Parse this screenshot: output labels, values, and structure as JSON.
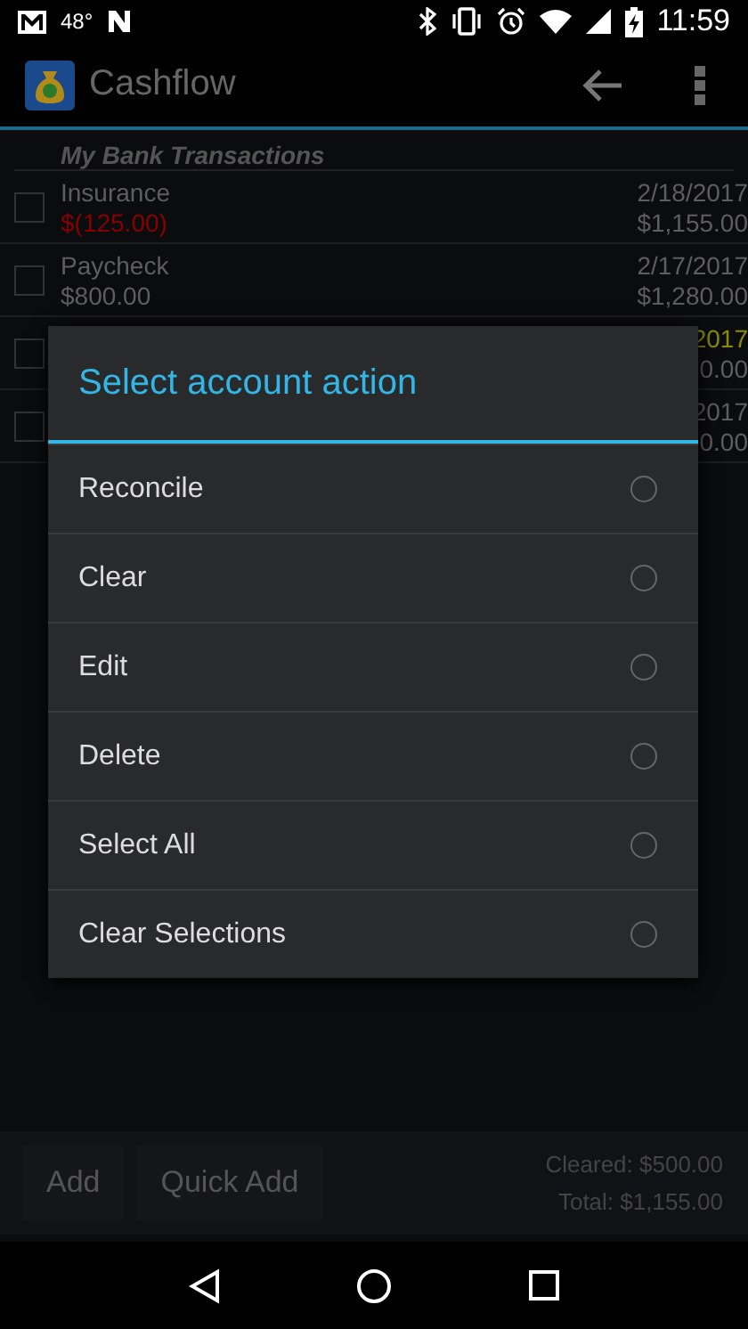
{
  "status_bar": {
    "temperature": "48°",
    "time": "11:59"
  },
  "app_bar": {
    "title": "Cashflow"
  },
  "section_title": "My Bank Transactions",
  "transactions": [
    {
      "name": "Insurance",
      "amount": "$(125.00)",
      "negative": true,
      "date": "2/18/2017",
      "balance": "$1,155.00",
      "checked": false
    },
    {
      "name": "Paycheck",
      "amount": "$800.00",
      "negative": false,
      "date": "2/17/2017",
      "balance": "$1,280.00",
      "checked": false
    },
    {
      "date": "2017",
      "balance": "0.00",
      "color": "#8c8c00",
      "checked": false
    },
    {
      "date": "2017",
      "balance": "0.00",
      "checked": false
    }
  ],
  "dialog": {
    "title": "Select account action",
    "options": [
      {
        "label": "Reconcile",
        "selected": false
      },
      {
        "label": "Clear",
        "selected": false
      },
      {
        "label": "Edit",
        "selected": false
      },
      {
        "label": "Delete",
        "selected": false
      },
      {
        "label": "Select All",
        "selected": false
      },
      {
        "label": "Clear Selections",
        "selected": false
      }
    ]
  },
  "bottom_bar": {
    "buttons": [
      "Add",
      "Quick Add"
    ],
    "cleared": "Cleared: $500.00",
    "total": "Total: $1,155.00"
  }
}
